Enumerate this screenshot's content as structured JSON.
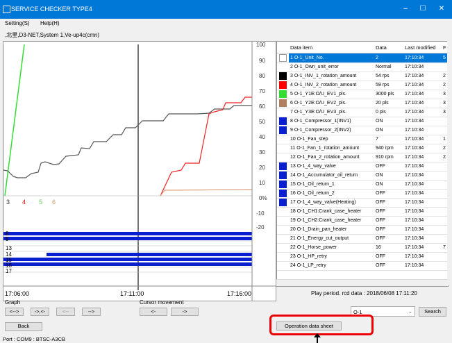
{
  "window": {
    "title": "SERVICE CHECKER TYPE4",
    "minimize": "–",
    "maximize": "☐",
    "close": "✕"
  },
  "menu": {
    "setting": "Setting(S)",
    "help": "Help(H)"
  },
  "info": ",北里,D3-NET,System 1,Ve-up4c(cmn)",
  "graph": {
    "y_ticks": [
      "100",
      "90",
      "80",
      "70",
      "60",
      "50",
      "40",
      "30",
      "20",
      "10",
      "0%",
      "-10",
      "-20"
    ],
    "series_markers": [
      {
        "label": "3",
        "color": "#333"
      },
      {
        "label": "4",
        "color": "#e00"
      },
      {
        "label": "5",
        "color": "#6c6"
      },
      {
        "label": "6",
        "color": "#c96"
      }
    ],
    "bar_labels": [
      "8",
      "9",
      "13",
      "14",
      "15",
      "16",
      "17"
    ],
    "time_labels": [
      "17:06:00",
      "17:11:00",
      "17:16:00"
    ]
  },
  "table": {
    "headers": [
      "Data item",
      "Data",
      "Last modified",
      "F"
    ],
    "rows": [
      {
        "item": "1 O-1_Unit_No.",
        "data": "2",
        "time": "17:10:34",
        "f": "5",
        "swatch": "#ffffff",
        "selected": true
      },
      {
        "item": "2 O-1_Own_unit_error",
        "data": "Normal",
        "time": "17:10:34",
        "f": "",
        "swatch": ""
      },
      {
        "item": "3 O-1_INV_1_rotation_amount",
        "data": "54 rps",
        "time": "17:10:34",
        "f": "2",
        "swatch": "#000000"
      },
      {
        "item": "4 O-1_INV_2_rotation_amount",
        "data": "59 rps",
        "time": "17:10:34",
        "f": "2",
        "swatch": "#ff0000"
      },
      {
        "item": "5 O-1_Y1E:O/U_EV1_pls.",
        "data": "3000 pls",
        "time": "17:10:34",
        "f": "3",
        "swatch": "#33dd33"
      },
      {
        "item": "6 O-1_Y2E:O/U_EV2_pls.",
        "data": "20 pls",
        "time": "17:10:34",
        "f": "3",
        "swatch": "#b08060"
      },
      {
        "item": "7 O-1_Y3E:O/U_EV3_pls.",
        "data": "0 pls",
        "time": "17:10:34",
        "f": "3",
        "swatch": ""
      },
      {
        "item": "8 O-1_Compressor_1(INV1)",
        "data": "ON",
        "time": "17:10:34",
        "f": "",
        "swatch": "#0a20d0"
      },
      {
        "item": "9 O-1_Compressor_2(INV2)",
        "data": "ON",
        "time": "17:10:34",
        "f": "",
        "swatch": "#0a20d0"
      },
      {
        "item": "10 O-1_Fan_step",
        "data": "7",
        "time": "17:10:34",
        "f": "1",
        "swatch": ""
      },
      {
        "item": "11 O-1_Fan_1_rotation_amount",
        "data": "940 rpm",
        "time": "17:10:34",
        "f": "2",
        "swatch": ""
      },
      {
        "item": "12 O-1_Fan_2_rotation_amount",
        "data": "910 rpm",
        "time": "17:10:34",
        "f": "2",
        "swatch": ""
      },
      {
        "item": "13 O-1_4_way_valve",
        "data": "OFF",
        "time": "17:10:34",
        "f": "",
        "swatch": "#0a20d0"
      },
      {
        "item": "14 O-1_Accumulator_oil_return",
        "data": "ON",
        "time": "17:10:34",
        "f": "",
        "swatch": "#0a20d0"
      },
      {
        "item": "15 O-1_Oil_return_1",
        "data": "ON",
        "time": "17:10:34",
        "f": "",
        "swatch": "#0a20d0"
      },
      {
        "item": "16 O-1_Oil_return_2",
        "data": "OFF",
        "time": "17:10:34",
        "f": "",
        "swatch": "#0a20d0"
      },
      {
        "item": "17 O-1_4_way_valve(Heating)",
        "data": "OFF",
        "time": "17:10:34",
        "f": "",
        "swatch": "#0a20d0"
      },
      {
        "item": "18 O-1_CH1:Crank_case_heater",
        "data": "OFF",
        "time": "17:10:34",
        "f": "",
        "swatch": ""
      },
      {
        "item": "19 O-1_CH2:Crank_case_heater",
        "data": "OFF",
        "time": "17:10:34",
        "f": "",
        "swatch": ""
      },
      {
        "item": "20 O-1_Drain_pan_heater",
        "data": "OFF",
        "time": "17:10:34",
        "f": "",
        "swatch": ""
      },
      {
        "item": "21 O-1_Energy_cut_output",
        "data": "OFF",
        "time": "17:10:34",
        "f": "",
        "swatch": ""
      },
      {
        "item": "22 O-1_Horse_power",
        "data": "16",
        "time": "17:10:34",
        "f": "7",
        "swatch": ""
      },
      {
        "item": "23 O-1_HP_retry",
        "data": "OFF",
        "time": "17:10:34",
        "f": "",
        "swatch": ""
      },
      {
        "item": "24 O-1_LP_retry",
        "data": "OFF",
        "time": "17:10:34",
        "f": "",
        "swatch": ""
      }
    ]
  },
  "controls": {
    "graph_label": "Graph",
    "cursor_label": "Cursor movement",
    "btn_expand": "<-->",
    "btn_shrink": "->,<-",
    "btn_left": "<--",
    "btn_right": "-->",
    "cursor_left": "<-",
    "cursor_right": "->",
    "back": "Back",
    "play_period": "Play period. rcd data : 2018/06/08 17:11:20",
    "unit_select": "O-1",
    "search": "Search",
    "operation_sheet": "Operation data sheet"
  },
  "status": "Port : COM9 : BTSC-A3CB"
}
